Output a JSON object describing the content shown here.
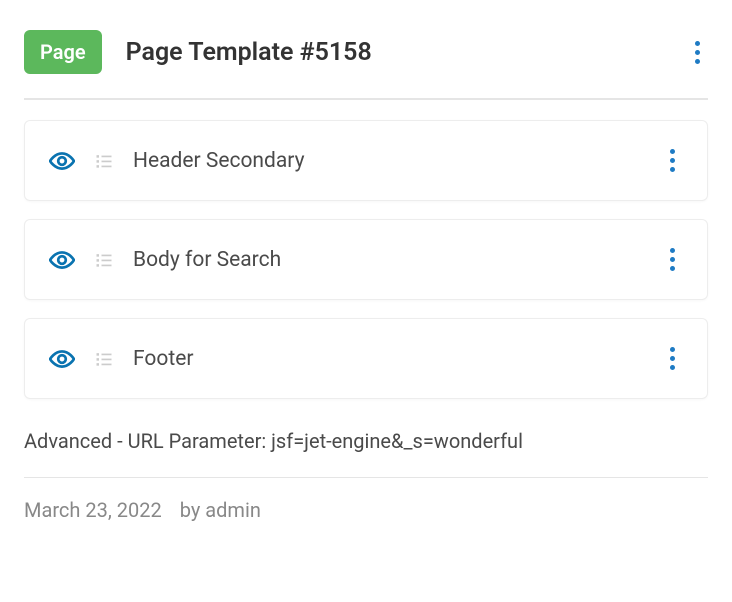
{
  "header": {
    "badge": "Page",
    "title": "Page Template #5158"
  },
  "templates": [
    {
      "label": "Header Secondary"
    },
    {
      "label": "Body for Search"
    },
    {
      "label": "Footer"
    }
  ],
  "advanced": "Advanced - URL Parameter: jsf=jet-engine&_s=wonderful",
  "meta": {
    "date": "March 23, 2022",
    "author": "by admin"
  }
}
